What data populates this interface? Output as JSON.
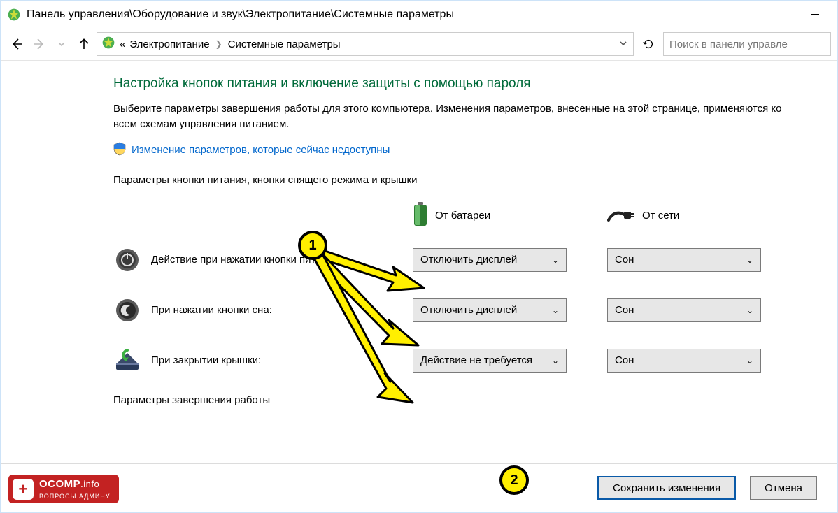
{
  "window": {
    "title": "Панель управления\\Оборудование и звук\\Электропитание\\Системные параметры"
  },
  "breadcrumb": {
    "prefix": "«",
    "item1": "Электропитание",
    "item2": "Системные параметры"
  },
  "search": {
    "placeholder": "Поиск в панели управле"
  },
  "heading": "Настройка кнопок питания и включение защиты с помощью пароля",
  "description": "Выберите параметры завершения работы для этого компьютера. Изменения параметров, внесенные на этой странице, применяются ко всем схемам управления питанием.",
  "uac_link": "Изменение параметров, которые сейчас недоступны",
  "section1": "Параметры кнопки питания, кнопки спящего режима и крышки",
  "columns": {
    "battery": "От батареи",
    "plugged": "От сети"
  },
  "rows": [
    {
      "label": "Действие при нажатии кнопки питания:",
      "battery": "Отключить дисплей",
      "plugged": "Сон"
    },
    {
      "label": "При нажатии кнопки сна:",
      "battery": "Отключить дисплей",
      "plugged": "Сон"
    },
    {
      "label": "При закрытии крышки:",
      "battery": "Действие не требуется",
      "plugged": "Сон"
    }
  ],
  "section2": "Параметры завершения работы",
  "buttons": {
    "save": "Сохранить изменения",
    "cancel": "Отмена"
  },
  "annotations": {
    "m1": "1",
    "m2": "2"
  },
  "logo": {
    "main": "OCOMP",
    "suffix": ".info",
    "sub": "ВОПРОСЫ АДМИНУ"
  }
}
